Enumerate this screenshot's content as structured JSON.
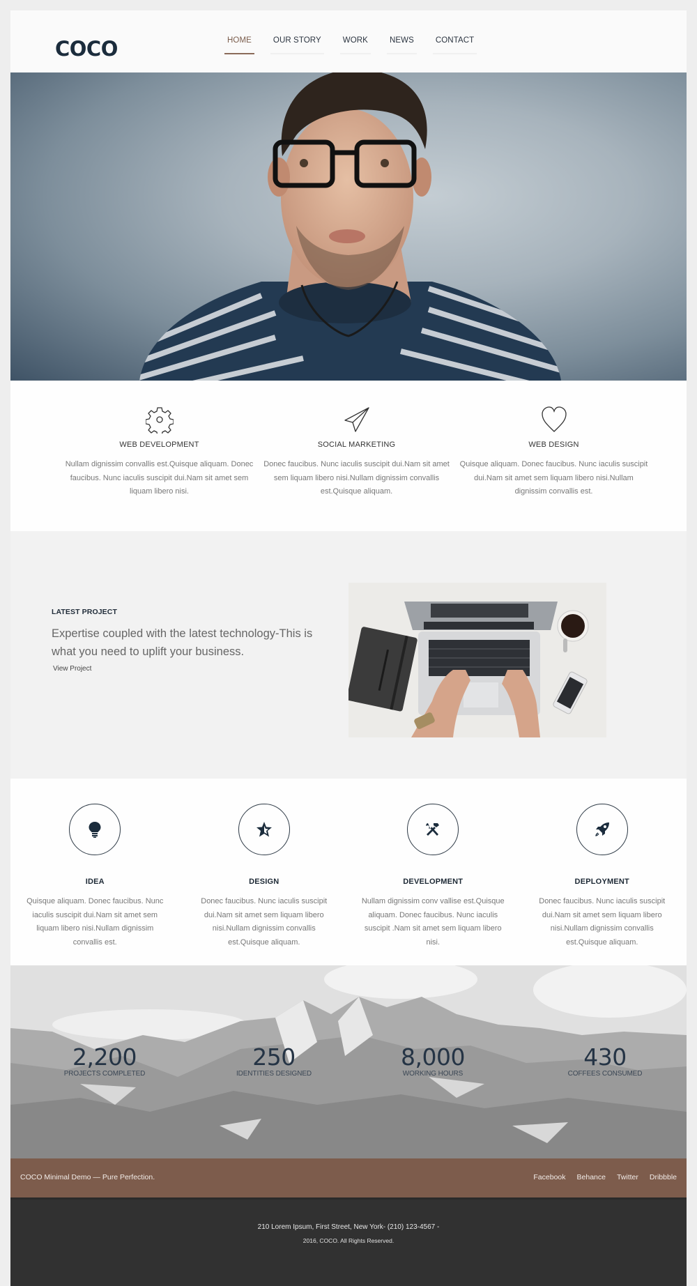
{
  "header": {
    "logo": "COCO",
    "nav": [
      {
        "label": "HOME",
        "active": true
      },
      {
        "label": "OUR STORY",
        "active": false
      },
      {
        "label": "WORK",
        "active": false
      },
      {
        "label": "NEWS",
        "active": false
      },
      {
        "label": "CONTACT",
        "active": false
      }
    ]
  },
  "hero": {
    "image": "portrait-man-glasses-striped-sweater"
  },
  "services": [
    {
      "icon": "gear-icon",
      "title": "WEB DEVELOPMENT",
      "text": "Nullam dignissim convallis est.Quisque aliquam. Donec faucibus. Nunc iaculis suscipit dui.Nam sit amet sem liquam libero nisi."
    },
    {
      "icon": "paper-plane-icon",
      "title": "SOCIAL MARKETING",
      "text": "Donec faucibus. Nunc iaculis suscipit dui.Nam sit amet sem liquam libero nisi.Nullam dignissim convallis est.Quisque aliquam."
    },
    {
      "icon": "heart-icon",
      "title": "WEB DESIGN",
      "text": "Quisque aliquam. Donec faucibus. Nunc iaculis suscipit dui.Nam sit amet sem liquam libero nisi.Nullam dignissim convallis est."
    }
  ],
  "latest": {
    "label": "LATEST PROJECT",
    "heading": "Expertise coupled with the latest technology-This is what you need to uplift your business.",
    "link": "View Project",
    "image": "laptop-desk-top-view"
  },
  "process": [
    {
      "icon": "lightbulb-icon",
      "title": "IDEA",
      "text": "Quisque aliquam. Donec faucibus. Nunc iaculis suscipit dui.Nam sit amet sem liquam libero nisi.Nullam dignissim convallis est."
    },
    {
      "icon": "star-icon",
      "title": "DESIGN",
      "text": "Donec faucibus. Nunc iaculis suscipit dui.Nam sit amet sem liquam libero nisi.Nullam dignissim convallis est.Quisque aliquam."
    },
    {
      "icon": "tools-icon",
      "title": "DEVELOPMENT",
      "text": "Nullam dignissim conv vallise est.Quisque aliquam. Donec faucibus. Nunc iaculis suscipit .Nam sit amet sem liquam libero nisi."
    },
    {
      "icon": "rocket-icon",
      "title": "DEPLOYMENT",
      "text": "Donec faucibus. Nunc iaculis suscipit dui.Nam sit amet sem liquam libero nisi.Nullam dignissim convallis est.Quisque aliquam."
    }
  ],
  "stats": [
    {
      "value": "2,200",
      "label": "PROJECTS COMPLETED"
    },
    {
      "value": "250",
      "label": "IDENTITIES DESIGNED"
    },
    {
      "value": "8,000",
      "label": "WORKING HOURS"
    },
    {
      "value": "430",
      "label": "COFFEES CONSUMED"
    }
  ],
  "footer": {
    "tagline": "COCO Minimal Demo — Pure Perfection.",
    "links": [
      "Facebook",
      "Behance",
      "Twitter",
      "Dribbble"
    ],
    "address": "210 Lorem Ipsum, First Street, New York- (210) 123-4567 -",
    "copyright": "2016, COCO. All Rights Reserved."
  },
  "colors": {
    "navy": "#1b2c3c",
    "accent_brown": "#7d5c4c",
    "footer_dark": "#313131"
  }
}
